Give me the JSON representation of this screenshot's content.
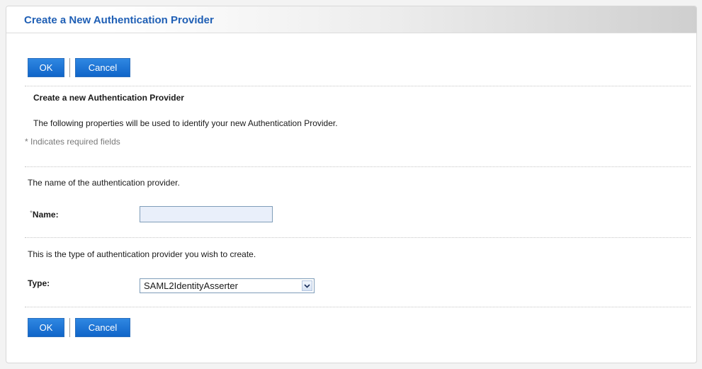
{
  "header": {
    "title": "Create a New Authentication Provider"
  },
  "actions": {
    "ok_label": "OK",
    "cancel_label": "Cancel"
  },
  "section": {
    "heading": "Create a new Authentication Provider",
    "description": "The following properties will be used to identify your new Authentication Provider.",
    "required_note": "* Indicates required fields"
  },
  "name_field": {
    "help": "The name of the authentication provider.",
    "required_mark": "*",
    "label": "Name:",
    "value": ""
  },
  "type_field": {
    "help": "This is the type of authentication provider you wish to create.",
    "label": "Type:",
    "selected": "SAML2IdentityAsserter"
  },
  "icons": {
    "dropdown": "chevron-down-icon"
  }
}
